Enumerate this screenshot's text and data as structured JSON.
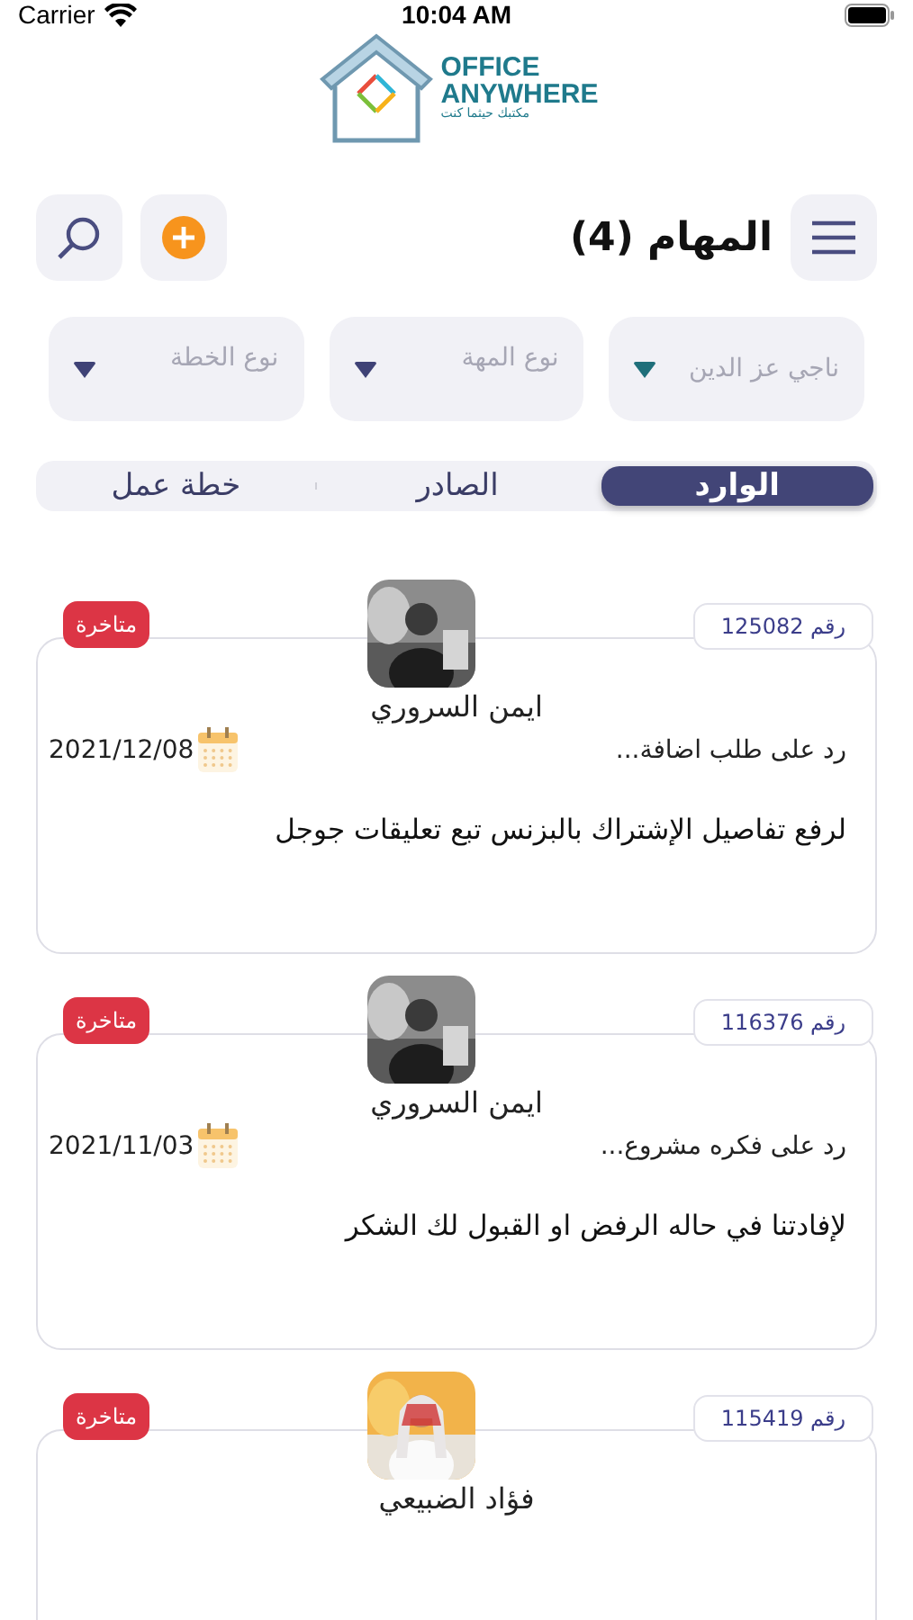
{
  "status_bar": {
    "carrier": "Carrier",
    "time": "10:04 AM"
  },
  "logo": {
    "line1": "OFFICE",
    "line2": "ANYWHERE",
    "tagline": "مكتبك حيثما كنت"
  },
  "header": {
    "title": "المهام (4)"
  },
  "filters": [
    {
      "value": "ناجي عز الدين"
    },
    {
      "placeholder": "نوع المهة"
    },
    {
      "placeholder": "نوع الخطة"
    }
  ],
  "tabs": [
    {
      "label": "الوارد",
      "selected": true
    },
    {
      "label": "الصادر",
      "selected": false
    },
    {
      "label": "خطة عمل",
      "selected": false
    }
  ],
  "tasks": [
    {
      "number": "رقم 125082",
      "status": "متاخرة",
      "person": "ايمن السروري",
      "subject": "رد على طلب اضافة...",
      "date": "2021/12/08",
      "description": "لرفع تفاصيل الإشتراك بالبزنس تبع تعليقات جوجل"
    },
    {
      "number": "رقم 116376",
      "status": "متاخرة",
      "person": "ايمن السروري",
      "subject": "رد على فكره مشروع...",
      "date": "2021/11/03",
      "description": "لإفادتنا في حاله الرفض او القبول لك الشكر"
    },
    {
      "number": "رقم 115419",
      "status": "متاخرة",
      "person": "فؤاد الضبيعي"
    }
  ]
}
